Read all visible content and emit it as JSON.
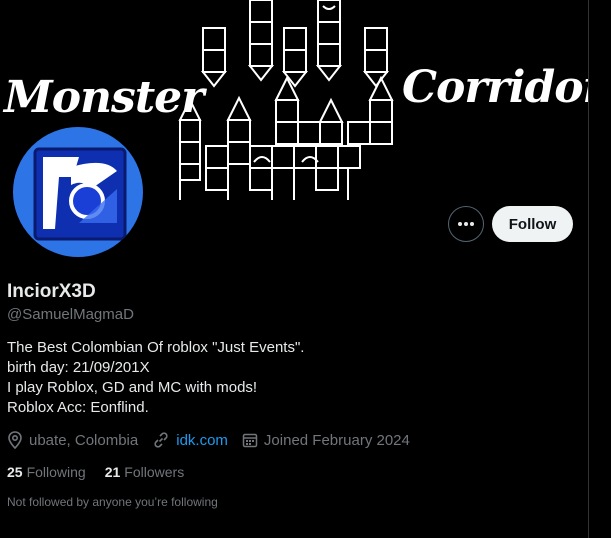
{
  "banner": {
    "title_left": "Monster",
    "title_right": "Corridor"
  },
  "profile": {
    "display_name": "InciorX3D",
    "handle": "@SamuelMagmaD",
    "bio_lines": [
      "The Best Colombian Of roblox \"Just Events\".",
      "birth day: 21/09/201X",
      "I play Roblox, GD and MC with mods!",
      "Roblox Acc: Eonflind."
    ],
    "location": "ubate, Colombia",
    "website": "idk.com",
    "joined": "Joined February 2024",
    "following_count": "25",
    "following_label": "Following",
    "followers_count": "21",
    "followers_label": "Followers",
    "not_followed_text": "Not followed by anyone you’re following"
  },
  "actions": {
    "follow_label": "Follow",
    "more_icon": "more-horizontal-icon"
  },
  "colors": {
    "background": "#000000",
    "text": "#e7e9ea",
    "secondary": "#71767b",
    "link": "#1d9bf0",
    "avatar_bg": "#2d74e6"
  }
}
